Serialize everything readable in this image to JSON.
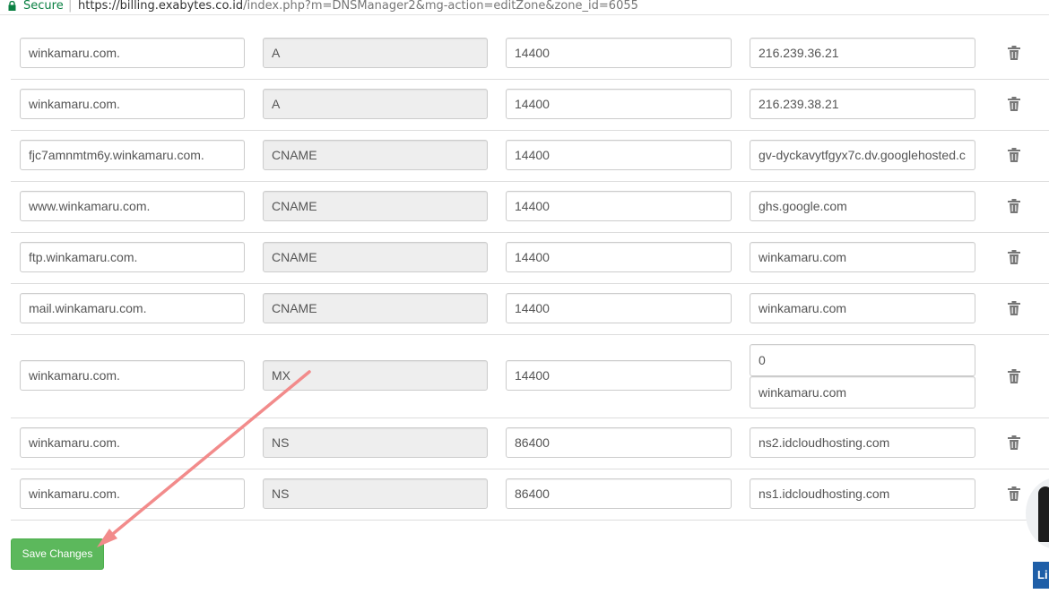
{
  "browser": {
    "secure_label": "Secure",
    "url_host": "https://billing.exabytes.co.id",
    "url_path": "/index.php?m=DNSManager2&mg-action=editZone&zone_id=6055"
  },
  "records": [
    {
      "name": "winkamaru.com.",
      "type": "A",
      "ttl": "14400",
      "value": "216.239.36.21"
    },
    {
      "name": "winkamaru.com.",
      "type": "A",
      "ttl": "14400",
      "value": "216.239.38.21"
    },
    {
      "name": "fjc7amnmtm6y.winkamaru.com.",
      "type": "CNAME",
      "ttl": "14400",
      "value": "gv-dyckavytfgyx7c.dv.googlehosted.c"
    },
    {
      "name": "www.winkamaru.com.",
      "type": "CNAME",
      "ttl": "14400",
      "value": "ghs.google.com"
    },
    {
      "name": "ftp.winkamaru.com.",
      "type": "CNAME",
      "ttl": "14400",
      "value": "winkamaru.com"
    },
    {
      "name": "mail.winkamaru.com.",
      "type": "CNAME",
      "ttl": "14400",
      "value": "winkamaru.com"
    },
    {
      "name": "winkamaru.com.",
      "type": "MX",
      "ttl": "14400",
      "priority": "0",
      "value": "winkamaru.com"
    },
    {
      "name": "winkamaru.com.",
      "type": "NS",
      "ttl": "86400",
      "value": "ns2.idcloudhosting.com"
    },
    {
      "name": "winkamaru.com.",
      "type": "NS",
      "ttl": "86400",
      "value": "ns1.idcloudhosting.com"
    }
  ],
  "icons": {
    "delete": "trash-icon",
    "secure": "lock-icon"
  },
  "actions": {
    "save_label": "Save Changes"
  },
  "chat_widget": {
    "tag": "Li"
  },
  "colors": {
    "save_button": "#5cb85c",
    "readonly_field": "#eeeeee",
    "annotation_arrow": "#f28b8b",
    "secure_green": "#0b8043"
  }
}
